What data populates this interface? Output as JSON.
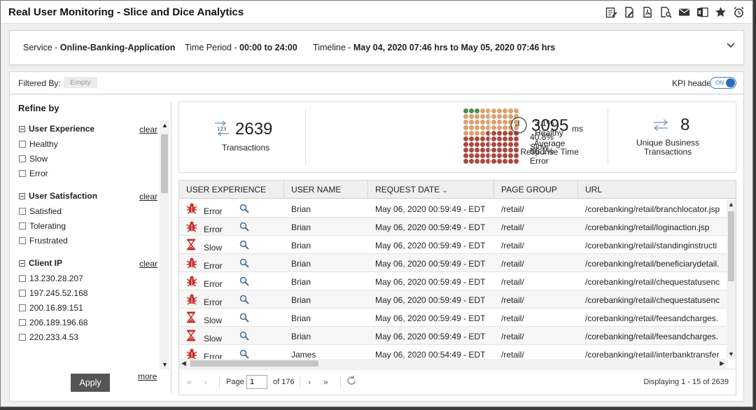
{
  "window": {
    "title": "Real User Monitoring - Slice and Dice Analytics"
  },
  "toolbar_icons": [
    "edit-report-icon",
    "edit-doc-icon",
    "pdf-icon",
    "search-doc-icon",
    "email-icon",
    "excel-icon",
    "star-icon",
    "alarm-icon"
  ],
  "service_bar": {
    "service_label": "Service - ",
    "service_value": "Online-Banking-Application",
    "period_label": "Time Period - ",
    "period_value": "00:00 to 24:00",
    "timeline_label": "Timeline - ",
    "timeline_value": "May 04, 2020 07:46 hrs to May 05, 2020 07:46 hrs"
  },
  "filter": {
    "label": "Filtered By:",
    "value": "Empty",
    "kpi_label": "KPI header",
    "toggle": "ON"
  },
  "refine": {
    "title": "Refine by",
    "clear_label": "clear",
    "more_label": "more",
    "apply_label": "Apply",
    "groups": [
      {
        "name": "User Experience",
        "options": [
          "Healthy",
          "Slow",
          "Error"
        ]
      },
      {
        "name": "User Satisfaction",
        "options": [
          "Satisfied",
          "Tolerating",
          "Frustrated"
        ]
      },
      {
        "name": "Client IP",
        "options": [
          "13.230.28.207",
          "197.245.52.168",
          "200.16.89.151",
          "206.189.196.68",
          "220.233.4.53"
        ]
      }
    ]
  },
  "kpi": {
    "transactions": {
      "value": "2639",
      "label": "Transactions",
      "icon_text": "123"
    },
    "distribution": [
      {
        "pct": "3.1%",
        "label": "Healthy",
        "color": "#4f8a4f"
      },
      {
        "pct": "40.8%",
        "label": "Slow",
        "color": "#d9a36f"
      },
      {
        "pct": "56.1%",
        "label": "Error",
        "color": "#a84a42"
      }
    ],
    "dot_counts": {
      "healthy": 3,
      "slow": 41,
      "error": 56
    },
    "response": {
      "value": "3095",
      "unit": "ms",
      "label1": "Average",
      "label2": "Response Time"
    },
    "unique": {
      "value": "8",
      "label1": "Unique Business",
      "label2": "Transactions"
    }
  },
  "table": {
    "columns": [
      "USER EXPERIENCE",
      "USER NAME",
      "REQUEST DATE",
      "PAGE GROUP",
      "URL"
    ],
    "rows": [
      {
        "ux": "Error",
        "user": "Brian",
        "date": "May 06, 2020 00:59:49 - EDT",
        "group": "/retail/",
        "url": "/corebanking/retail/branchlocator.jsp"
      },
      {
        "ux": "Error",
        "user": "Brian",
        "date": "May 06, 2020 00:59:49 - EDT",
        "group": "/retail/",
        "url": "/corebanking/retail/loginaction.jsp"
      },
      {
        "ux": "Slow",
        "user": "Brian",
        "date": "May 06, 2020 00:59:49 - EDT",
        "group": "/retail/",
        "url": "/corebanking/retail/standinginstructi"
      },
      {
        "ux": "Error",
        "user": "Brian",
        "date": "May 06, 2020 00:59:49 - EDT",
        "group": "/retail/",
        "url": "/corebanking/retail/beneficiarydetail."
      },
      {
        "ux": "Error",
        "user": "Brian",
        "date": "May 06, 2020 00:59:49 - EDT",
        "group": "/retail/",
        "url": "/corebanking/retail/chequestatusenc"
      },
      {
        "ux": "Error",
        "user": "Brian",
        "date": "May 06, 2020 00:59:49 - EDT",
        "group": "/retail/",
        "url": "/corebanking/retail/chequestatusenc"
      },
      {
        "ux": "Slow",
        "user": "Brian",
        "date": "May 06, 2020 00:59:49 - EDT",
        "group": "/retail/",
        "url": "/corebanking/retail/feesandcharges."
      },
      {
        "ux": "Slow",
        "user": "Brian",
        "date": "May 06, 2020 00:59:49 - EDT",
        "group": "/retail/",
        "url": "/corebanking/retail/feesandcharges."
      },
      {
        "ux": "Error",
        "user": "James",
        "date": "May 06, 2020 00:54:49 - EDT",
        "group": "/retail/",
        "url": "/corebanking/retail/interbanktransfer"
      }
    ]
  },
  "pager": {
    "page_label": "Page",
    "page_value": "1",
    "of_label": "of 176",
    "display": "Displaying 1 - 15 of 2639"
  },
  "colors": {
    "accent": "#2c6db5",
    "error": "#c8302a",
    "slow": "#c8302a"
  }
}
